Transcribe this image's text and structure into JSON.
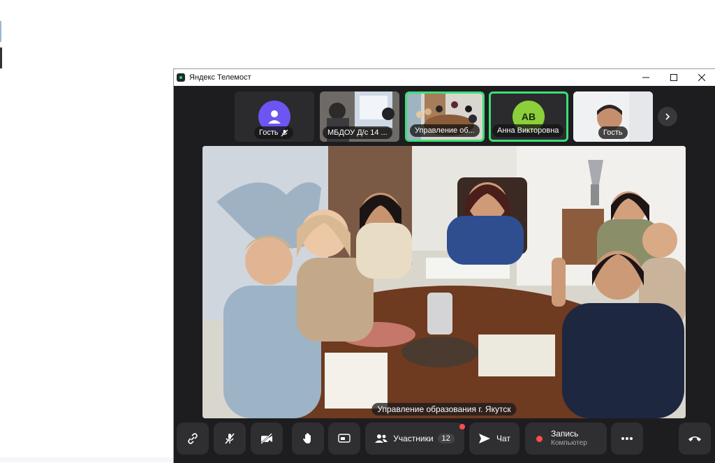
{
  "window": {
    "title": "Яндекс Телемост"
  },
  "participants": [
    {
      "name": "Гость",
      "type": "avatar",
      "avatar_color": "#6c55f0",
      "muted": true,
      "active": false
    },
    {
      "name": "МБДОУ Д/с 14 ...",
      "type": "video",
      "muted": false,
      "active": false
    },
    {
      "name": "Управление об...",
      "type": "video",
      "muted": false,
      "active": true
    },
    {
      "name": "Анна Викторовна",
      "type": "initials",
      "initials": "АВ",
      "avatar_color": "#8bcf3a",
      "muted": false,
      "active": true
    },
    {
      "name": "Гость",
      "type": "video",
      "muted": false,
      "active": false
    }
  ],
  "main_video": {
    "caption": "Управление образования г. Якутск"
  },
  "toolbar": {
    "participants_label": "Участники",
    "participants_count": "12",
    "chat_label": "Чат",
    "record_label": "Запись",
    "record_sub": "Компьютер"
  },
  "colors": {
    "accent_green": "#3fdc77",
    "record_red": "#ff4d4d",
    "panel": "#2f2f31"
  }
}
